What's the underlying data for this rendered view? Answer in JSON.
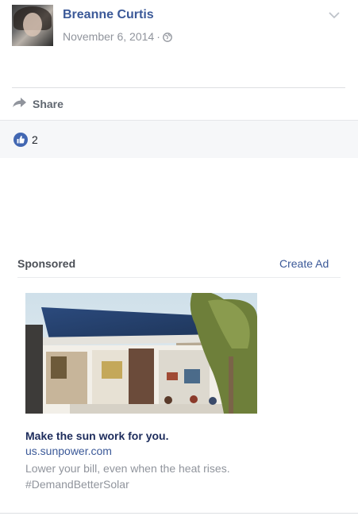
{
  "post": {
    "author": "Breanne Curtis",
    "date": "November 6, 2014",
    "separator": "·",
    "privacy_icon": "globe-icon",
    "share_label": "Share",
    "reaction_count": "2",
    "colors": {
      "author": "#3b5998",
      "like": "#4267b2"
    }
  },
  "ad": {
    "sponsored_label": "Sponsored",
    "create_ad_label": "Create Ad",
    "title": "Make the sun work for you.",
    "url": "us.sunpower.com",
    "description_line1": "Lower your bill, even when the heat rises.",
    "description_line2": "#DemandBetterSolar"
  }
}
